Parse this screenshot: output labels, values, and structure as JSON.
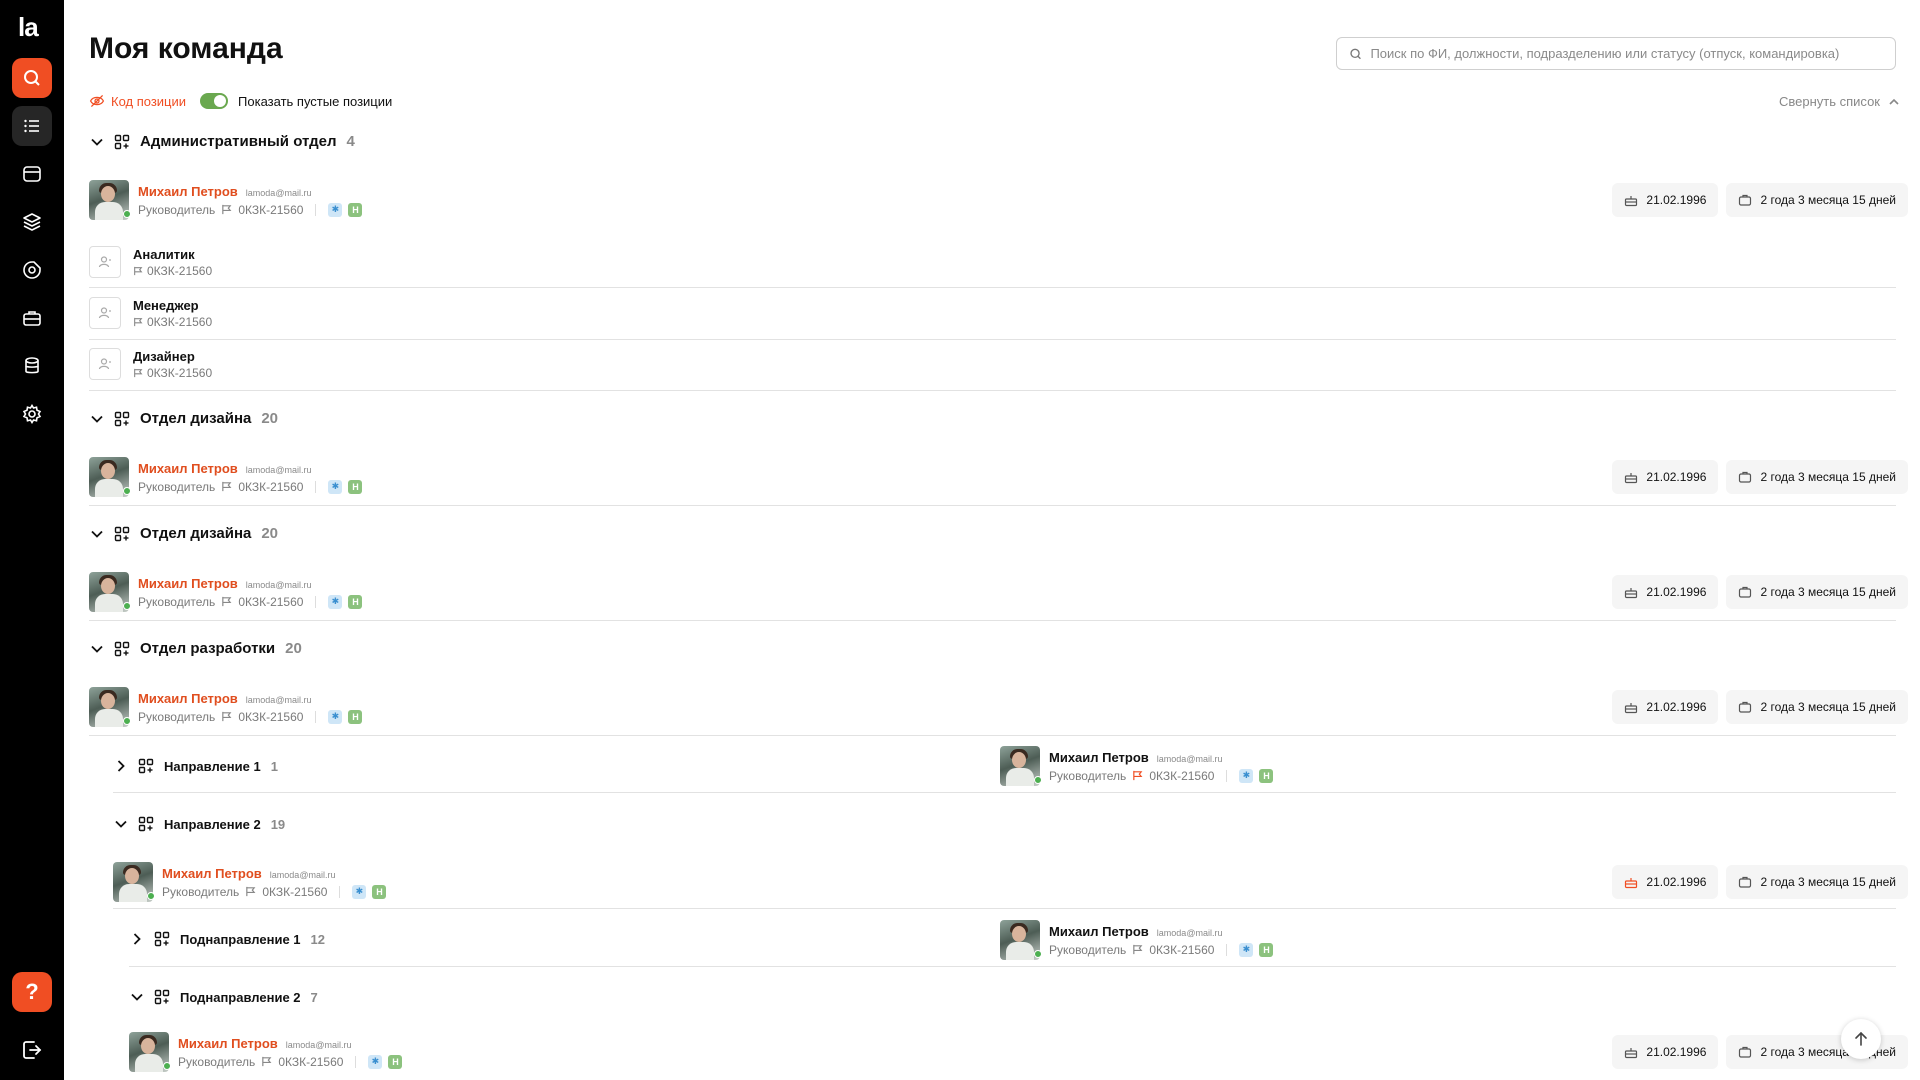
{
  "brand": {
    "logo": "la"
  },
  "page": {
    "title": "Моя команда"
  },
  "search": {
    "placeholder": "Поиск по ФИ, должности, подразделению или статусу (отпуск, командировка)"
  },
  "filters": {
    "code_label": "Код позиции",
    "show_empty_label": "Показать пустые позиции",
    "show_empty_enabled": true
  },
  "collapse": {
    "label": "Свернуть список"
  },
  "colors": {
    "accent": "#f04e23",
    "online": "#4caf50",
    "toggle": "#6aa84f"
  },
  "person": {
    "name": "Михаил Петров",
    "email": "lamoda@mail.ru",
    "role": "Руководитель",
    "code": "0КЗК-21560",
    "badge_h": "Н",
    "birth": "21.02.1996",
    "tenure": "2 года 3 месяца 15 дней"
  },
  "groups": [
    {
      "name": "Административный отдел",
      "count": "4"
    },
    {
      "name": "Отдел дизайна",
      "count": "20"
    },
    {
      "name": "Отдел дизайна",
      "count": "20"
    },
    {
      "name": "Отдел разработки",
      "count": "20"
    }
  ],
  "subgroups": [
    {
      "name": "Направление 1",
      "count": "1"
    },
    {
      "name": "Направление 2",
      "count": "19"
    },
    {
      "name": "Поднаправление 1",
      "count": "12"
    },
    {
      "name": "Поднаправление 2",
      "count": "7"
    }
  ],
  "vacancies": [
    {
      "title": "Аналитик",
      "code": "0КЗК-21560"
    },
    {
      "title": "Менеджер",
      "code": "0КЗК-21560"
    },
    {
      "title": "Дизайнер",
      "code": "0КЗК-21560"
    }
  ],
  "help": {
    "label": "?"
  }
}
